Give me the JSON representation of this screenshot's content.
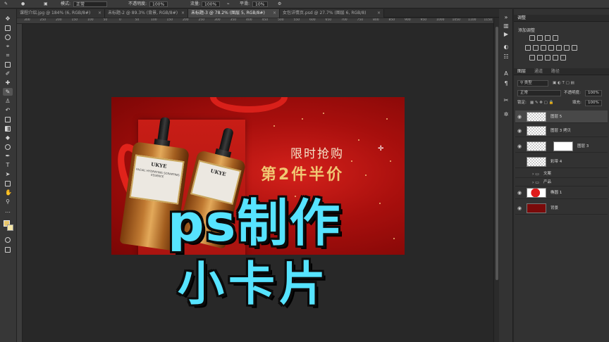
{
  "options_bar": {
    "mode_label": "模式:",
    "mode_value": "正常",
    "opacity_label": "不透明度:",
    "opacity_value": "100%",
    "flow_label": "流量:",
    "flow_value": "100%",
    "smooth_label": "平滑:",
    "smooth_value": "10%"
  },
  "tabs": [
    {
      "label": "课程介绍.jpg @ 184% (6, RGB/8#)",
      "active": false
    },
    {
      "label": "未标题-2 @ 89.3% (背景, RGB/8#)",
      "active": false
    },
    {
      "label": "未标题-3 @ 78.2% (图层 5, RGB/8#)",
      "active": true
    },
    {
      "label": "女包详情页.psd @ 27.7% (图层 6, RGB/8)",
      "active": false
    }
  ],
  "ruler_ticks": [
    "300",
    "250",
    "200",
    "150",
    "100",
    "50",
    "0",
    "50",
    "100",
    "150",
    "200",
    "250",
    "300",
    "350",
    "400",
    "450",
    "500",
    "550",
    "600",
    "650",
    "700",
    "750",
    "800",
    "850",
    "900",
    "950",
    "1000",
    "1050",
    "1100",
    "1150",
    "1200"
  ],
  "document": {
    "headline": "限时抢购",
    "subline": "第2件半价",
    "bottle_label": "UKYE",
    "bottle_small": "FACIAL HYDRATING SCRAPPING ESSENCE"
  },
  "overlay_title": {
    "line1": "ps制作",
    "line2": "小卡片",
    "color": "#56e3ff"
  },
  "panels": {
    "adjust_tab": "调整",
    "adjust_title": "添加调整",
    "layer_tabs": [
      "图层",
      "通道",
      "路径"
    ],
    "filter_kind": "类型",
    "blend_mode": "正常",
    "opacity_label": "不透明度:",
    "opacity_value": "100%",
    "lock_label": "锁定:",
    "fill_label": "填充:",
    "fill_value": "100%"
  },
  "layers": [
    {
      "name": "图层 5",
      "selected": true,
      "type": "pixel"
    },
    {
      "name": "图层 3 拷贝",
      "selected": false,
      "type": "pixel"
    },
    {
      "name": "图层 3",
      "selected": false,
      "type": "masked"
    },
    {
      "name": "彩带 4",
      "selected": false,
      "type": "pixel"
    },
    {
      "name": "文案",
      "selected": false,
      "type": "group"
    },
    {
      "name": "产品",
      "selected": false,
      "type": "group"
    },
    {
      "name": "椭圆 1",
      "selected": false,
      "type": "shape"
    },
    {
      "name": "背景",
      "selected": false,
      "type": "background"
    }
  ],
  "colors": {
    "background_layer": "#7a0a0a",
    "accent": "#56e3ff"
  }
}
